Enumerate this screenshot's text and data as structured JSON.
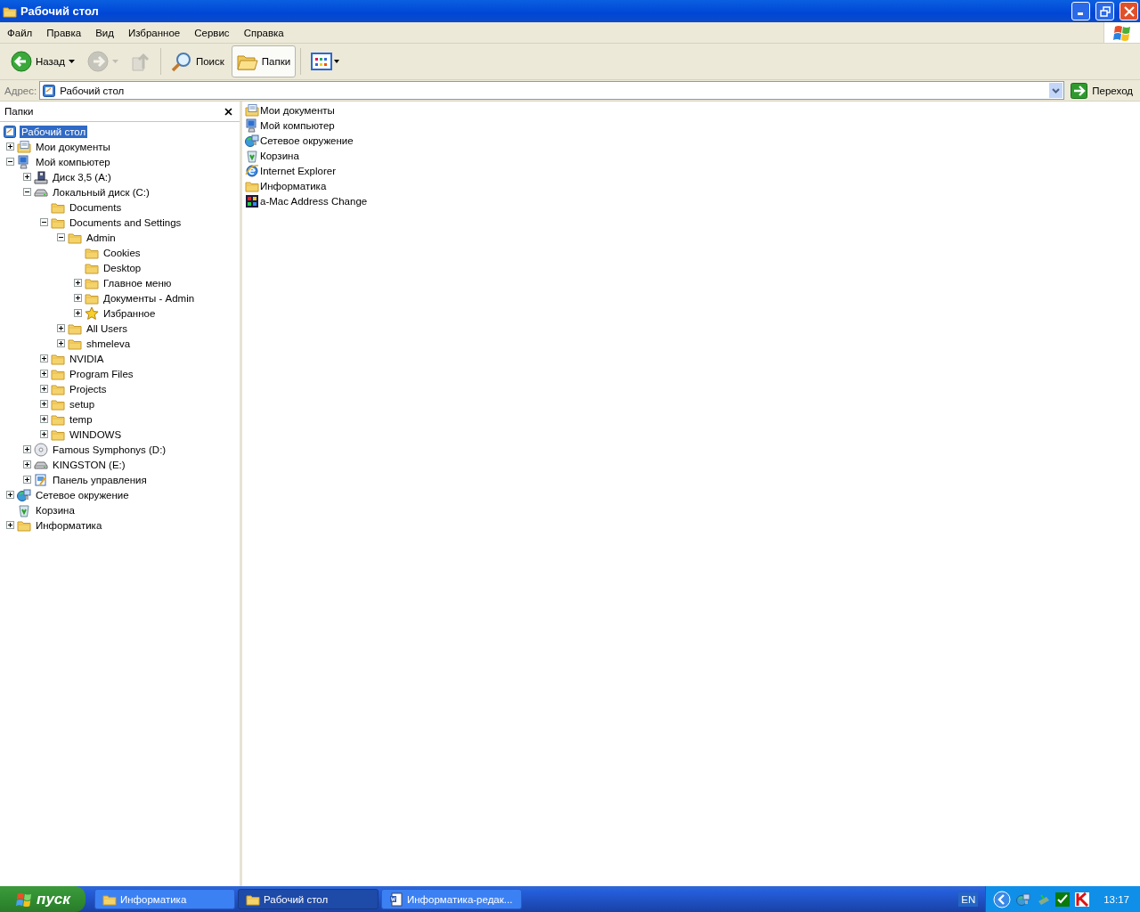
{
  "window": {
    "title": "Рабочий стол"
  },
  "menu": [
    "Файл",
    "Правка",
    "Вид",
    "Избранное",
    "Сервис",
    "Справка"
  ],
  "toolbar": {
    "back": {
      "label": "Назад",
      "disabled": false
    },
    "forward": {
      "disabled": true
    },
    "up": {
      "disabled": true
    },
    "search": {
      "label": "Поиск"
    },
    "folders": {
      "label": "Папки",
      "selected": true
    }
  },
  "address": {
    "label": "Адрес:",
    "value": "Рабочий стол",
    "go": "Переход"
  },
  "folders_pane": {
    "title": "Папки"
  },
  "tree": {
    "label": "Рабочий стол",
    "kind": "desktop",
    "selected": true,
    "children": [
      {
        "label": "Мои документы",
        "kind": "mydocs",
        "selected": false,
        "expanded": false
      },
      {
        "label": "Мой компьютер",
        "kind": "computer",
        "selected": false,
        "expanded": true,
        "children": [
          {
            "label": "Диск 3,5 (A:)",
            "kind": "floppy",
            "selected": false,
            "expanded": false
          },
          {
            "label": "Локальный диск (C:)",
            "kind": "drive",
            "selected": false,
            "expanded": true,
            "children": [
              {
                "label": "Documents",
                "kind": "folder",
                "selected": false
              },
              {
                "label": "Documents and Settings",
                "kind": "folder",
                "selected": false,
                "expanded": true,
                "children": [
                  {
                    "label": "Admin",
                    "kind": "folder",
                    "selected": false,
                    "expanded": true,
                    "children": [
                      {
                        "label": "Cookies",
                        "kind": "folder",
                        "selected": false
                      },
                      {
                        "label": "Desktop",
                        "kind": "folder",
                        "selected": false
                      },
                      {
                        "label": "Главное меню",
                        "kind": "folder",
                        "selected": false,
                        "expanded": false
                      },
                      {
                        "label": "Документы - Admin",
                        "kind": "folder",
                        "selected": false,
                        "expanded": false
                      },
                      {
                        "label": "Избранное",
                        "kind": "star",
                        "selected": false,
                        "expanded": false
                      }
                    ]
                  },
                  {
                    "label": "All Users",
                    "kind": "folder",
                    "selected": false,
                    "expanded": false
                  },
                  {
                    "label": "shmeleva",
                    "kind": "folder",
                    "selected": false,
                    "expanded": false
                  }
                ]
              },
              {
                "label": "NVIDIA",
                "kind": "folder",
                "selected": false,
                "expanded": false
              },
              {
                "label": "Program Files",
                "kind": "folder",
                "selected": false,
                "expanded": false
              },
              {
                "label": "Projects",
                "kind": "folder",
                "selected": false,
                "expanded": false
              },
              {
                "label": "setup",
                "kind": "folder",
                "selected": false,
                "expanded": false
              },
              {
                "label": "temp",
                "kind": "folder",
                "selected": false,
                "expanded": false
              },
              {
                "label": "WINDOWS",
                "kind": "folder",
                "selected": false,
                "expanded": false
              }
            ]
          },
          {
            "label": "Famous Symphonys (D:)",
            "kind": "cd",
            "selected": false,
            "expanded": false
          },
          {
            "label": "KINGSTON (E:)",
            "kind": "removable",
            "selected": false,
            "expanded": false
          },
          {
            "label": "Панель управления",
            "kind": "control",
            "selected": false,
            "expanded": false
          }
        ]
      },
      {
        "label": "Сетевое окружение",
        "kind": "network",
        "selected": false,
        "expanded": false
      },
      {
        "label": "Корзина",
        "kind": "recycle",
        "selected": false
      },
      {
        "label": "Информатика",
        "kind": "folder",
        "selected": false,
        "expanded": false
      }
    ]
  },
  "content": {
    "items": [
      {
        "label": "Мои документы",
        "kind": "mydocs"
      },
      {
        "label": "Мой компьютер",
        "kind": "computer"
      },
      {
        "label": "Сетевое окружение",
        "kind": "network"
      },
      {
        "label": "Корзина",
        "kind": "recycle"
      },
      {
        "label": "Internet Explorer",
        "kind": "ie"
      },
      {
        "label": "Информатика",
        "kind": "folder"
      },
      {
        "label": "a-Mac Address Change",
        "kind": "app"
      }
    ]
  },
  "taskbar": {
    "start": "пуск",
    "tasks": [
      {
        "label": "Информатика",
        "kind": "folder",
        "selected": false
      },
      {
        "label": "Рабочий стол",
        "kind": "explorer",
        "selected": true
      },
      {
        "label": "Информатика-редак...",
        "kind": "word",
        "selected": false
      }
    ],
    "language": "EN",
    "clock": "13:17"
  }
}
